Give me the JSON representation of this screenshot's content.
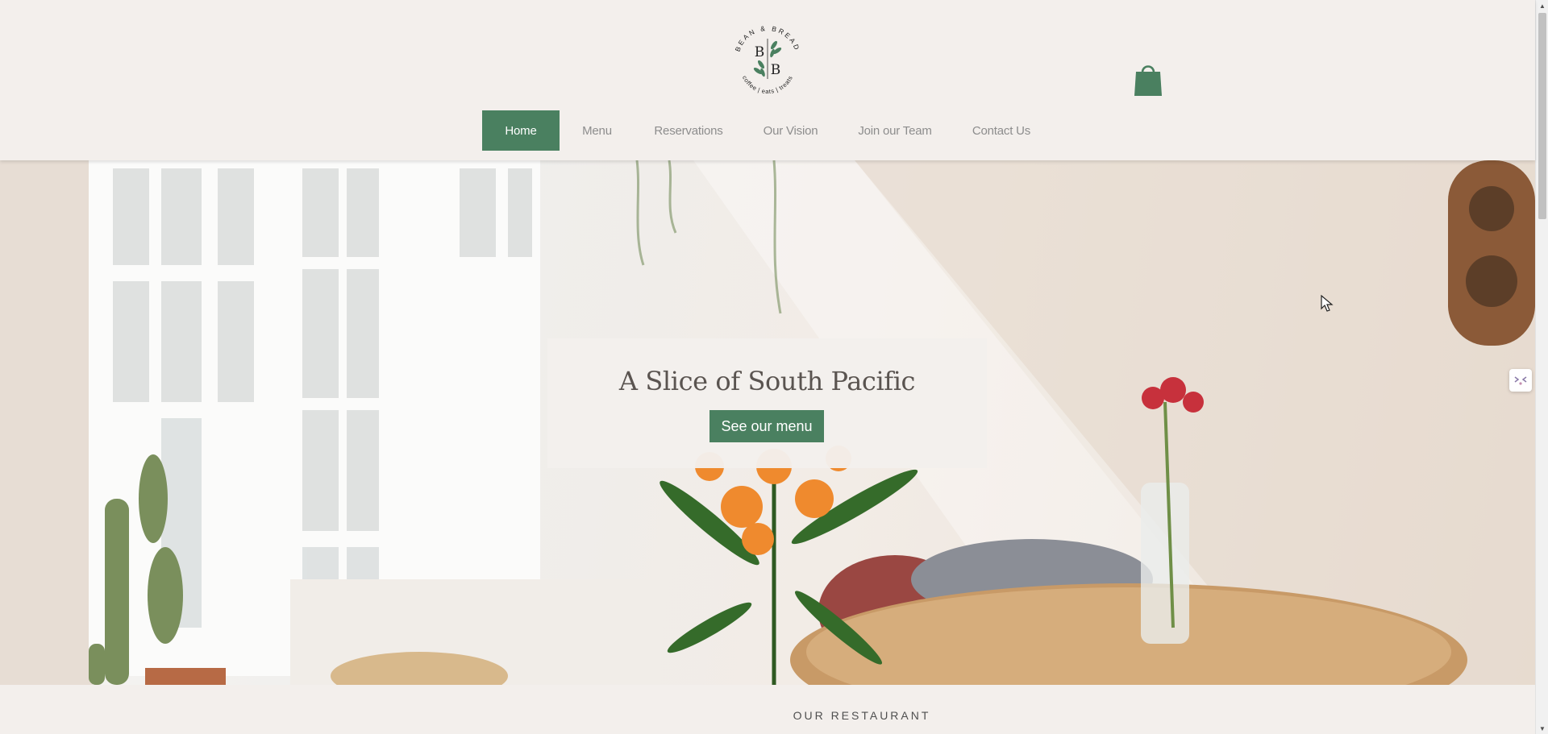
{
  "brand": {
    "name": "BEAN & BREAD",
    "initials_top": "B",
    "initials_bottom": "B",
    "tagline": "coffee | eats | treats",
    "logo_icon": "leaf-sprig-icon"
  },
  "header": {
    "cart_icon": "shopping-bag-icon"
  },
  "nav": {
    "items": [
      {
        "label": "Home",
        "active": true
      },
      {
        "label": "Menu",
        "active": false
      },
      {
        "label": "Reservations",
        "active": false
      },
      {
        "label": "Our Vision",
        "active": false
      },
      {
        "label": "Join our Team",
        "active": false
      },
      {
        "label": "Contact Us",
        "active": false
      }
    ]
  },
  "hero": {
    "title": "A Slice of South Pacific",
    "button_label": "See our menu"
  },
  "section": {
    "label": "OUR RESTAURANT"
  },
  "widgets": {
    "side_icon": "chat-widget-icon"
  },
  "colors": {
    "accent_green": "#4a8060",
    "header_bg": "#f3efec",
    "nav_text": "#8d8d8d",
    "title_text": "#5a5450"
  }
}
